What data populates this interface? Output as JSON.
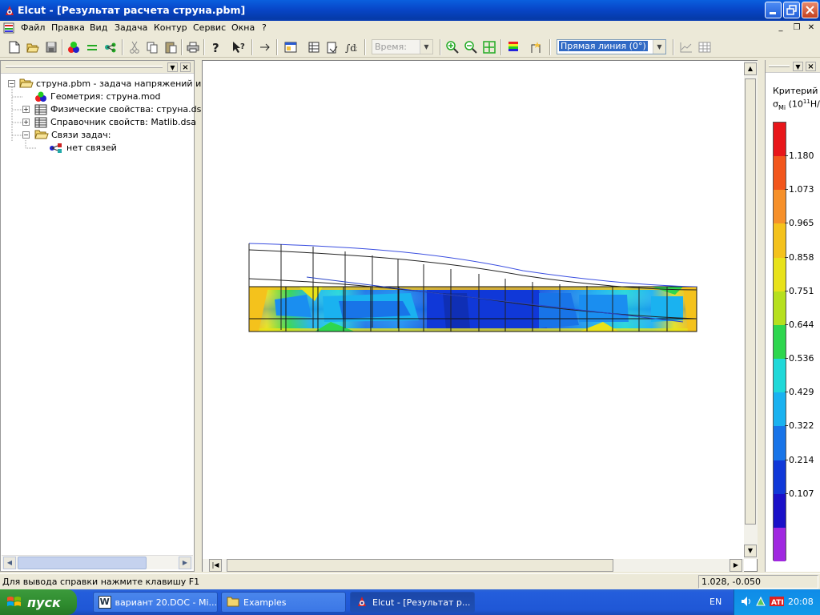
{
  "window": {
    "title": "Elcut - [Результат расчета струна.pbm]"
  },
  "menu": {
    "items": [
      "Файл",
      "Правка",
      "Вид",
      "Задача",
      "Контур",
      "Сервис",
      "Окна",
      "?"
    ]
  },
  "toolbar": {
    "time_placeholder": "Время:",
    "line_mode": "Прямая линия (0°)"
  },
  "tree": {
    "root": "струна.pbm -  задача напряжений и де",
    "geometry": "Геометрия: струна.mod",
    "physics": "Физические свойства: струна.dsa",
    "library": "Справочник свойств: Matlib.dsa",
    "links": "Связи задач:",
    "no_links": "нет связей"
  },
  "legend": {
    "title_line1": "Критерий М",
    "title_line2_symbol": "σ",
    "title_line2_sub": "Mi",
    "title_line2_unit": "(10",
    "title_line2_exp": "11",
    "title_line2_tail": "Н/",
    "values": [
      "1.180",
      "1.073",
      "0.965",
      "0.858",
      "0.751",
      "0.644",
      "0.536",
      "0.429",
      "0.322",
      "0.214",
      "0.107"
    ],
    "colors": [
      "#e8161a",
      "#f2561c",
      "#f6902a",
      "#f4c21c",
      "#e8e21a",
      "#b6e01e",
      "#2ed64e",
      "#20d8d8",
      "#1ab2f0",
      "#1874e8",
      "#1038d8",
      "#1a10c8",
      "#a028e0"
    ]
  },
  "status": {
    "help": "Для вывода справки нажмите клавишу F1",
    "coords": "1.028, -0.050"
  },
  "taskbar": {
    "start": "пуск",
    "tasks": [
      "вариант 20.DOC - Mi...",
      "Examples",
      "Elcut - [Результат р..."
    ],
    "lang": "EN",
    "clock": "20:08"
  }
}
